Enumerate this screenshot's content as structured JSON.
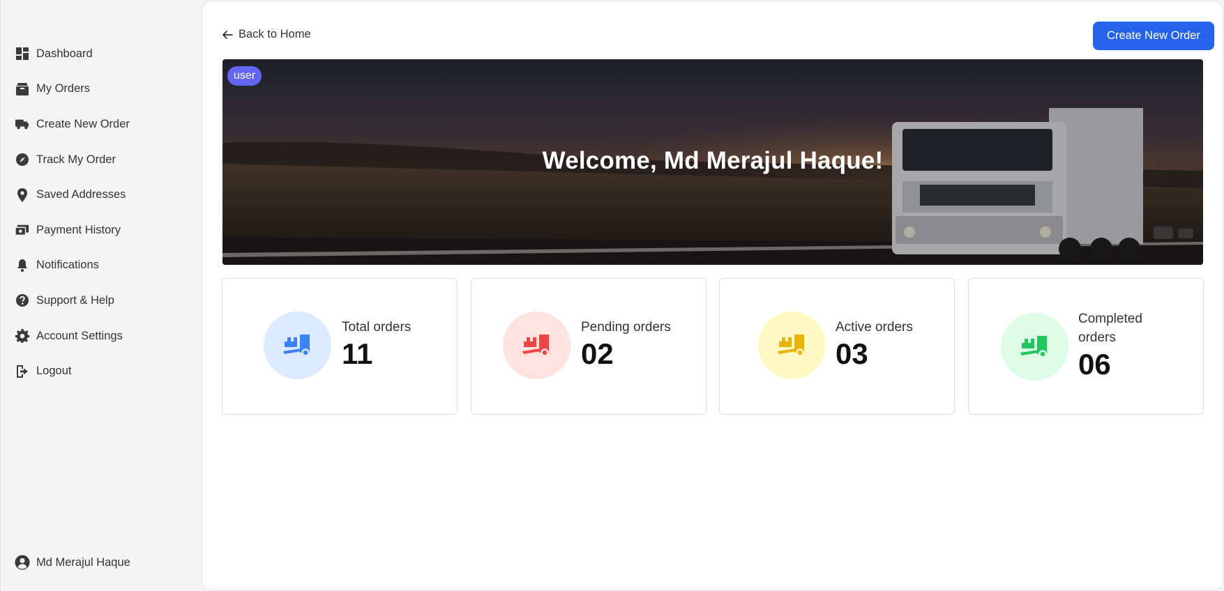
{
  "sidebar": {
    "items": [
      {
        "label": "Dashboard",
        "icon": "dashboard-icon"
      },
      {
        "label": "My Orders",
        "icon": "box-icon"
      },
      {
        "label": "Create New Order",
        "icon": "truck-icon"
      },
      {
        "label": "Track My Order",
        "icon": "compass-icon"
      },
      {
        "label": "Saved Addresses",
        "icon": "map-pin-icon"
      },
      {
        "label": "Payment History",
        "icon": "payment-icon"
      },
      {
        "label": "Notifications",
        "icon": "bell-icon"
      },
      {
        "label": "Support & Help",
        "icon": "help-icon"
      },
      {
        "label": "Account Settings",
        "icon": "gear-icon"
      },
      {
        "label": "Logout",
        "icon": "logout-icon"
      }
    ],
    "profile": {
      "name": "Md Merajul Haque",
      "icon": "user-circle-icon"
    }
  },
  "header": {
    "back_label": "Back to Home",
    "cta_label": "Create New Order"
  },
  "hero": {
    "role_badge": "user",
    "title": "Welcome, Md Merajul Haque!"
  },
  "stats": [
    {
      "label": "Total orders",
      "value": "11",
      "color": "#3b82f6",
      "bg": "#dbeafe"
    },
    {
      "label": "Pending orders",
      "value": "02",
      "color": "#ef4444",
      "bg": "#fee2e2"
    },
    {
      "label": "Active orders",
      "value": "03",
      "color": "#eab308",
      "bg": "#fef9c3"
    },
    {
      "label": "Completed orders",
      "value": "06",
      "color": "#22c55e",
      "bg": "#dcfce7"
    }
  ],
  "colors": {
    "accent": "#2563eb",
    "badge": "#6366f1"
  }
}
